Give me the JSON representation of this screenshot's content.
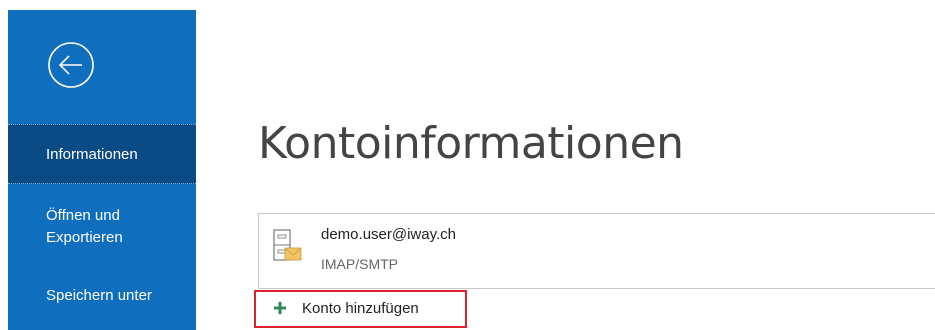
{
  "sidebar": {
    "back_icon": "back-arrow-icon",
    "items": [
      {
        "label": "Informationen",
        "active": true
      },
      {
        "label_line1": "Öffnen und",
        "label_line2": "Exportieren",
        "active": false
      },
      {
        "label": "Speichern unter",
        "active": false
      }
    ]
  },
  "main": {
    "title": "Kontoinformationen",
    "account": {
      "email": "demo.user@iway.ch",
      "type": "IMAP/SMTP",
      "icon": "mail-server-icon"
    },
    "add_account": {
      "label": "Konto hinzufügen",
      "icon": "plus-icon"
    }
  },
  "colors": {
    "sidebar_bg": "#106ebe",
    "sidebar_active_bg": "#0a4b85",
    "highlight_border": "#d9232e",
    "plus_green": "#2e8b57"
  }
}
